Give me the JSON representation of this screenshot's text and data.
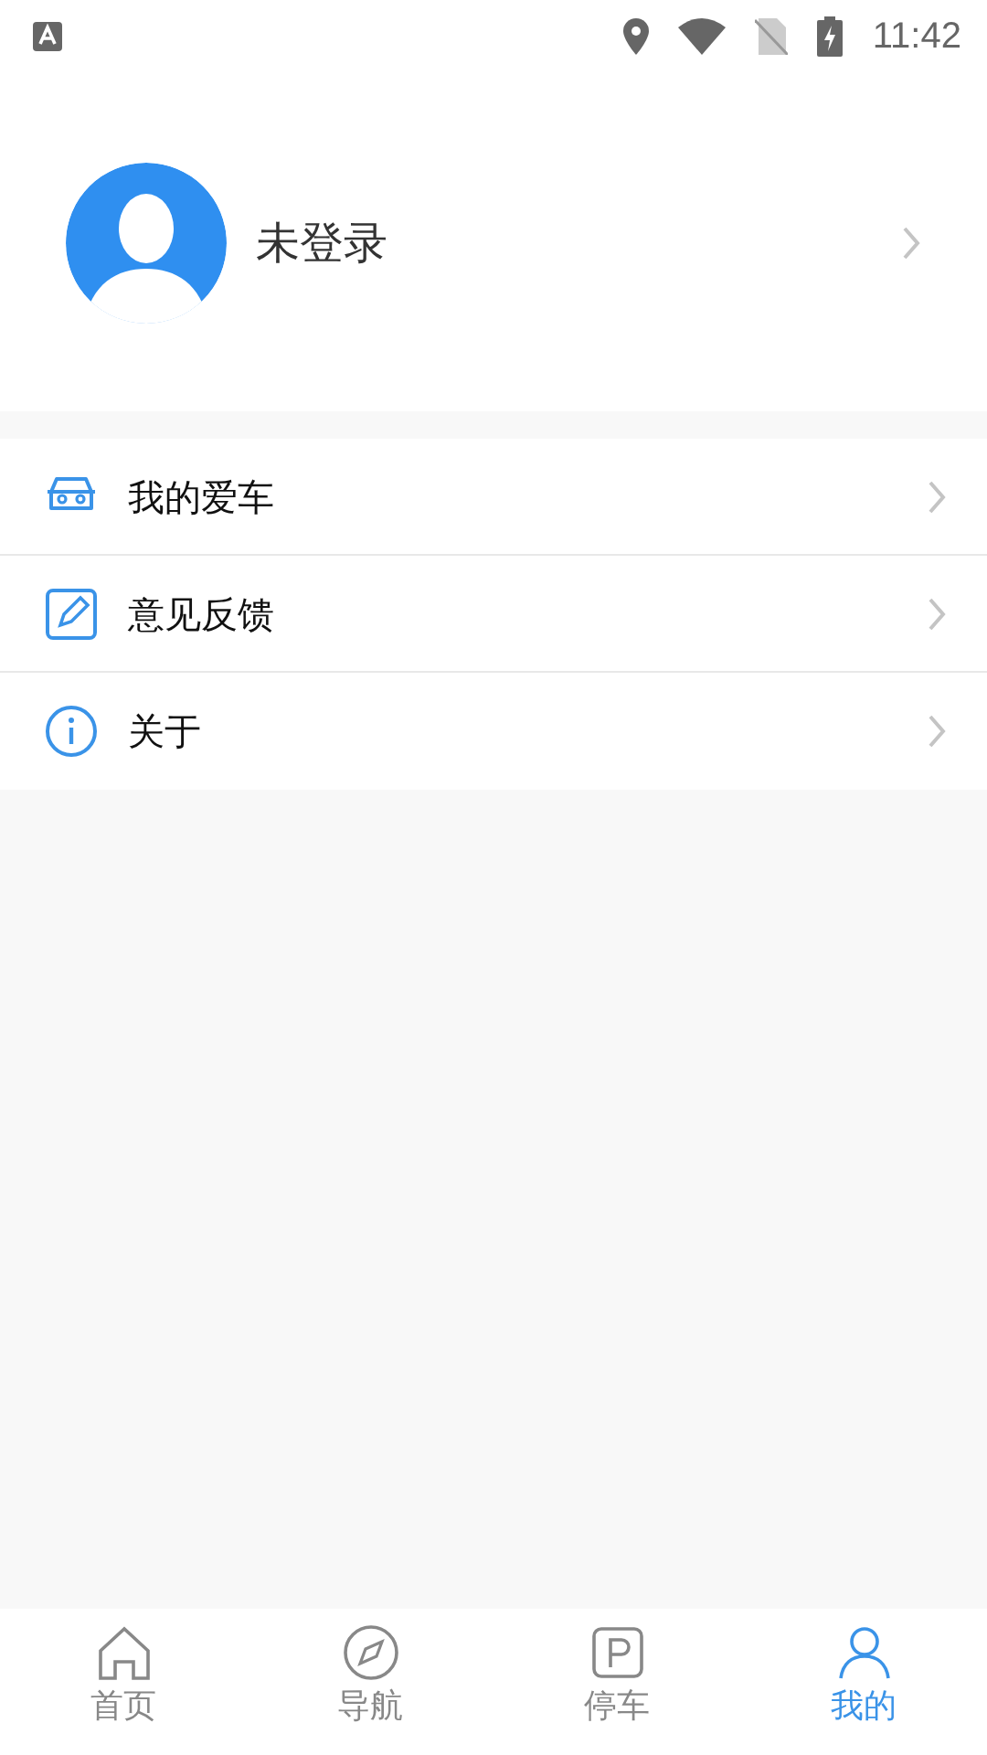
{
  "status_bar": {
    "time": "11:42"
  },
  "profile": {
    "name": "未登录"
  },
  "menu": [
    {
      "label": "我的爱车",
      "kind": "car"
    },
    {
      "label": "意见反馈",
      "kind": "feedback"
    },
    {
      "label": "关于",
      "kind": "about"
    }
  ],
  "tabs": [
    {
      "label": "首页",
      "kind": "home",
      "selected": false
    },
    {
      "label": "导航",
      "kind": "compass",
      "selected": false
    },
    {
      "label": "停车",
      "kind": "parking",
      "selected": false
    },
    {
      "label": "我的",
      "kind": "person",
      "selected": true
    }
  ]
}
